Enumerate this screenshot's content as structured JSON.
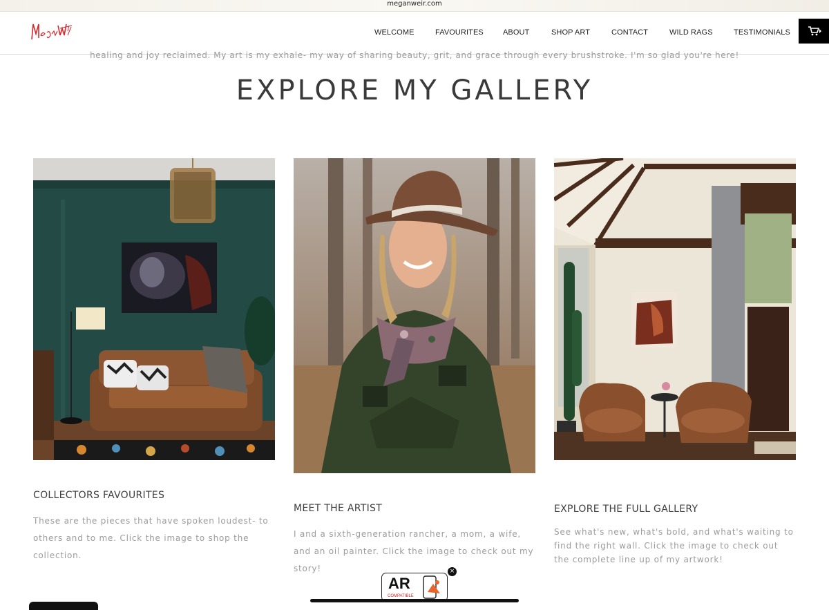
{
  "browser": {
    "url": "meganweir.com"
  },
  "brand": {
    "logo_alt": "Megan Weir"
  },
  "nav": {
    "items": [
      "WELCOME",
      "FAVOURITES",
      "ABOUT",
      "SHOP ART",
      "CONTACT",
      "WILD RAGS",
      "TESTIMONIALS"
    ],
    "cart_icon": "cart-icon"
  },
  "intro": {
    "text": "healing and joy reclaimed. My art is my exhale- my way of sharing beauty, grit, and grace through every brushstroke. I'm so glad you're here!"
  },
  "gallery": {
    "title": "EXPLORE MY GALLERY",
    "cards": [
      {
        "heading": "COLLECTORS FAVOURITES",
        "text": "These are the pieces that have spoken loudest- to others and to me. Click the image to shop the collection."
      },
      {
        "heading": "MEET THE ARTIST",
        "text": "I and a sixth-generation rancher, a mom, a wife, and an oil painter. Click the image to check out my story!"
      },
      {
        "heading": "EXPLORE THE FULL GALLERY",
        "text": "See what's new, what's bold, and what's waiting to find the right wall. Click the image to check out the complete line up of my artwork!"
      }
    ]
  },
  "ar": {
    "label": "AR",
    "sub": "COMPATIBLE",
    "close": "×"
  },
  "colors": {
    "accent": "#d9262c",
    "text": "#3a3a3a",
    "muted": "#9c9c9c"
  }
}
